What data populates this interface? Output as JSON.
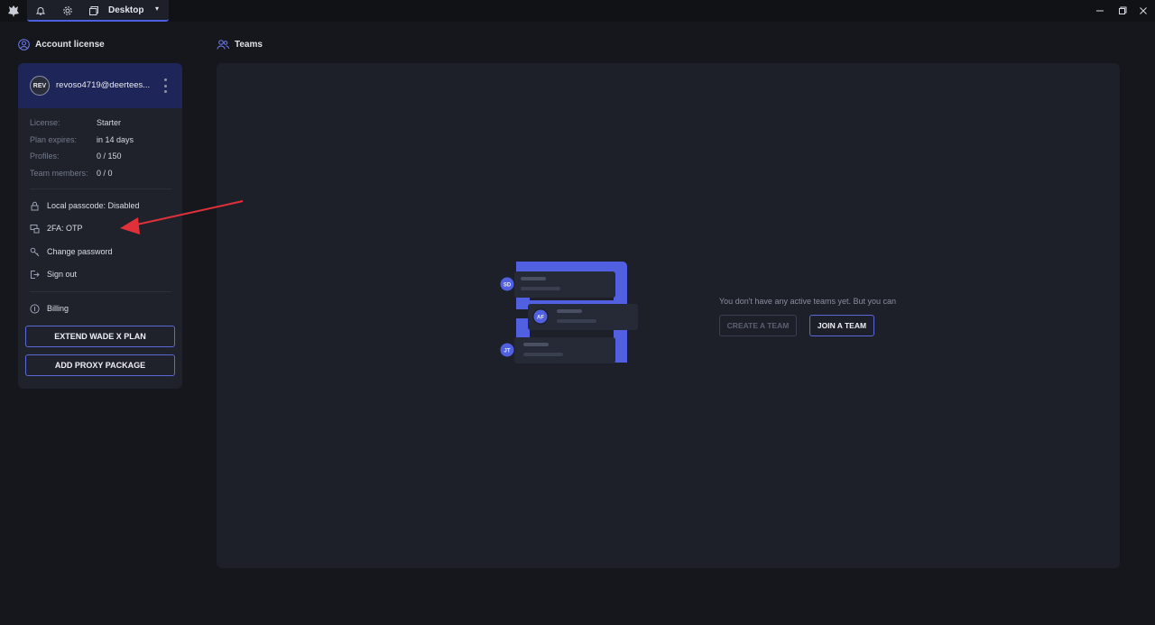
{
  "titlebar": {
    "logo_icon": "app-logo-icon",
    "notification_icon": "bell-icon",
    "settings_icon": "gear-icon",
    "workspace_icon": "windows-icon",
    "workspace_label": "Desktop",
    "workspace_caret": "▾",
    "window_controls": [
      "minimize-icon",
      "restore-icon",
      "close-icon"
    ]
  },
  "account": {
    "section_title": "Account license",
    "avatar_initials": "REV",
    "email": "revoso4719@deertees...",
    "details": [
      {
        "label": "License:",
        "value": "Starter"
      },
      {
        "label": "Plan expires:",
        "value": "in 14 days"
      },
      {
        "label": "Profiles:",
        "value": "0 / 150"
      },
      {
        "label": "Team members:",
        "value": "0 / 0"
      }
    ],
    "menu": {
      "local_passcode": "Local passcode: Disabled",
      "two_fa": "2FA: OTP",
      "change_password": "Change password",
      "sign_out": "Sign out",
      "billing": "Billing"
    },
    "buttons": {
      "extend": "EXTEND WADE X PLAN",
      "proxy": "ADD PROXY PACKAGE"
    }
  },
  "teams": {
    "section_title": "Teams",
    "empty_message": "You don't have any active teams yet. But you can",
    "create_button": "CREATE A TEAM",
    "join_button": "JOIN A TEAM",
    "illustration_badges": [
      "SD",
      "AF",
      "JT"
    ]
  },
  "colors": {
    "accent": "#5b68d8",
    "header_bg": "#1e2559",
    "annotation_arrow": "#e0303a"
  }
}
